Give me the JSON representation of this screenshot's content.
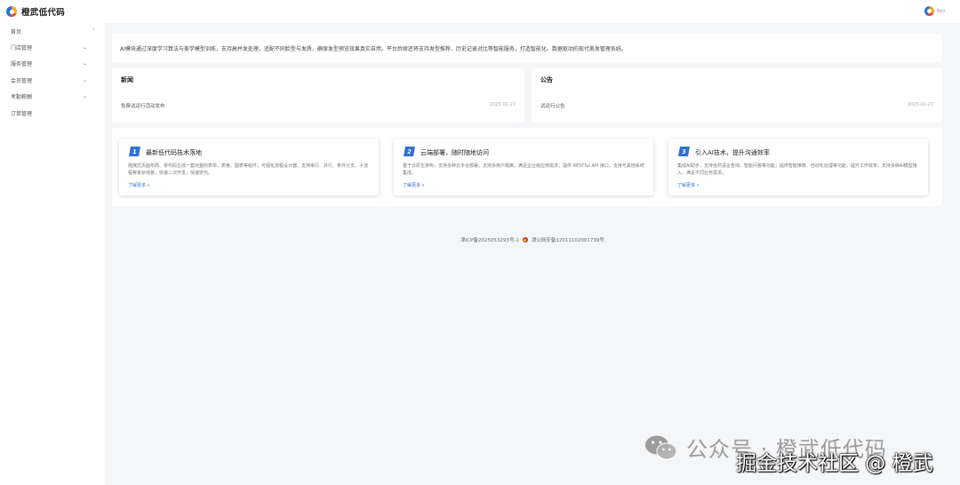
{
  "app": {
    "brand": "橙武低代码",
    "user_name": "Bell"
  },
  "sidebar": {
    "collapse_icon": "chevron-left-icon",
    "items": [
      {
        "label": "首页",
        "has_children": false
      },
      {
        "label": "门店管理",
        "has_children": true,
        "chevron": "⌄"
      },
      {
        "label": "服务管理",
        "has_children": true,
        "chevron": "⌄"
      },
      {
        "label": "会员管理",
        "has_children": true,
        "chevron": "⌄"
      },
      {
        "label": "考勤薪酬",
        "has_children": true,
        "chevron": "⌄"
      },
      {
        "label": "订单管理",
        "has_children": false
      }
    ],
    "collapse_label": "‹"
  },
  "intro": {
    "text": "AI模块通过深度学习算法与美学模型训练，支持高并发处理，适配不同脸型与发质，确保发型预览效果真实自然。平台后续还将支持发型推荐、历史记录对比等智能服务，打造智能化、数据驱动的现代美发管理系统。"
  },
  "news": {
    "title": "新闻",
    "items": [
      {
        "title": "免费试运行活动发布",
        "date": "2025-01-27"
      }
    ]
  },
  "notice": {
    "title": "公告",
    "items": [
      {
        "title": "试运行公告",
        "date": "2025-01-27"
      }
    ]
  },
  "features": [
    {
      "num": "1",
      "title": "最新低代码技术落地",
      "desc": "拖拽式页面布局、零代码生成一套完整的表单、表格、图表等组件；可视化流程设计器，支持串行、并行、条件分支、子流程等复杂场景，快速二次开发，快速迭代。",
      "more": "了解更多 »"
    },
    {
      "num": "2",
      "title": "云端部署，随时随地访问",
      "desc": "基于云原生架构，支持多种云平台部署；支持多用户隔离，满足企业级应用需求；提供 RESTful API 接口，支持与其他系统集成。",
      "more": "了解更多 »"
    },
    {
      "num": "3",
      "title": "引入AI技术，提升沟通效率",
      "desc": "集成AI助手，支持自然语言查询、智能问答等功能；提供智能推荐、自动化处理等功能，提升工作效率；支持多种AI模型接入，满足不同业务需求。",
      "more": "了解更多 »"
    }
  ],
  "footer": {
    "icp": "津ICP备2025053293号-1",
    "police": "津公网安备12011102001739号"
  },
  "watermark": {
    "line1": "公众号 · 橙武低代码",
    "line2": "掘金技术社区 @ 橙武",
    "icon": "wechat-icon"
  },
  "colors": {
    "accent": "#2f6fd6",
    "background": "#f5f6f8"
  }
}
